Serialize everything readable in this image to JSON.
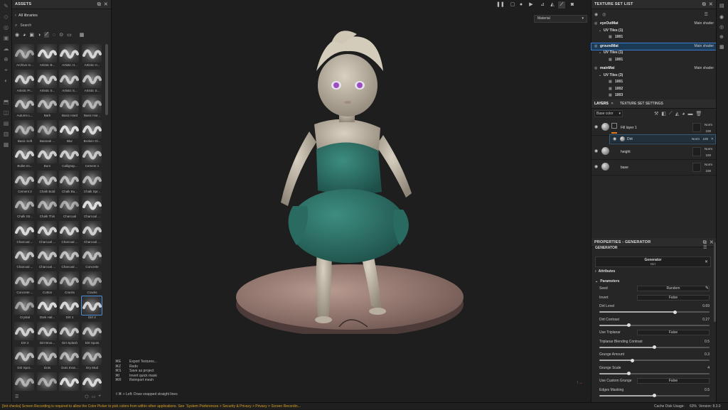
{
  "assets_panel": {
    "title": "ASSETS",
    "library": "All libraries",
    "search_placeholder": "Search",
    "brushes": [
      "Archive In...",
      "Artistic B...",
      "Artistic H...",
      "Artistic H...",
      "Artistic Pr...",
      "Artistic S...",
      "Artistic S...",
      "Artistic S...",
      "Autumn L...",
      "Bark",
      "Basic Hard",
      "Basic Har...",
      "Basic Soft",
      "Basmati ...",
      "Blur",
      "Broken Gl...",
      "Bullet Im...",
      "Burn",
      "Calligrap...",
      "Cement 1",
      "Cement 2",
      "Chalk Bold",
      "Chalk Bu...",
      "Chalk Spr...",
      "Chalk Str...",
      "Chalk Thin",
      "Charcoal",
      "Charcoal ...",
      "Charcoal ...",
      "Charcoal ...",
      "Charcoal ...",
      "Charcoal ...",
      "Charcoal ...",
      "Charcoal ...",
      "Charcoal ...",
      "Concrete",
      "Concrete ...",
      "Cotton",
      "Cracks",
      "Cracks",
      "Crystal",
      "Dark Hal...",
      "Dirt 1",
      "Dirt 2",
      "Dirt 3",
      "Dirt Brus...",
      "Dirt Splash",
      "Dirt Spots",
      "Dirt Spot...",
      "Dots",
      "Dots Eras...",
      "Dry Mud",
      "",
      "",
      "",
      ""
    ],
    "selected_brush": "Dirt 2"
  },
  "viewport": {
    "material_dropdown": "Material",
    "shortcuts": [
      {
        "key": "⌘E",
        "action": "Export Textures..."
      },
      {
        "key": "⌘Z",
        "action": "Redo"
      },
      {
        "key": "⌘S",
        "action": "Save as project"
      },
      {
        "key": "⌘I",
        "action": "Invert quick mask"
      },
      {
        "key": "⌘R",
        "action": "Reimport mesh"
      }
    ],
    "hint": "⇧⌘ + Left: Draw snapped straight lines"
  },
  "texture_set_list": {
    "title": "TEXTURE SET LIST",
    "sets": [
      {
        "name": "eyeOutMat",
        "shader": "Main shader",
        "uv_label": "UV Tiles (1)",
        "tiles": [
          "1001"
        ]
      },
      {
        "name": "groundMat",
        "shader": "Main shader",
        "uv_label": "UV Tiles (1)",
        "tiles": [
          "1001"
        ]
      },
      {
        "name": "mainMat",
        "shader": "Main shader",
        "uv_label": "UV Tiles (3)",
        "tiles": [
          "1001",
          "1002",
          "1003"
        ]
      }
    ],
    "selected": "groundMat"
  },
  "layers_panel": {
    "tab_layers": "LAYERS",
    "tab_settings": "TEXTURE SET SETTINGS",
    "channel": "Base color",
    "layers": [
      {
        "name": "Fill layer 1",
        "blend": "Norm",
        "opacity": "100"
      },
      {
        "name": "Dirt",
        "blend": "Norm",
        "opacity": "100"
      },
      {
        "name": "height",
        "blend": "Norm",
        "opacity": "100"
      },
      {
        "name": "base",
        "blend": "Norm",
        "opacity": "100"
      }
    ]
  },
  "properties": {
    "title": "PROPERTIES - GENERATOR",
    "section": "GENERATOR",
    "generator_name": "Generator",
    "generator_sub": "Dirt",
    "attributes": "Attributes",
    "parameters": "Parameters",
    "params": [
      {
        "label": "Seed",
        "type": "field",
        "value": "Random"
      },
      {
        "label": "Invert",
        "type": "field",
        "value": "False"
      },
      {
        "label": "Dirt Level",
        "type": "slider",
        "value": "0.69",
        "fraction": 0.69
      },
      {
        "label": "Dirt Contrast",
        "type": "slider",
        "value": "0.27",
        "fraction": 0.27
      },
      {
        "label": "Use Triplanar",
        "type": "field",
        "value": "False"
      },
      {
        "label": "Triplanar Blending Contrast",
        "type": "slider",
        "value": "0.5",
        "fraction": 0.5
      },
      {
        "label": "Grunge Amount",
        "type": "slider",
        "value": "0.3",
        "fraction": 0.3
      },
      {
        "label": "Grunge Scale",
        "type": "slider",
        "value": "4",
        "fraction": 0.27
      },
      {
        "label": "Use Custom Grunge",
        "type": "field",
        "value": "False"
      },
      {
        "label": "Edges Masking",
        "type": "slider",
        "value": "0.5",
        "fraction": 0.5
      }
    ]
  },
  "status_bar": {
    "message": "[Init checks] Screen Recording is required to allow the Color Picker to pick colors from within other applications. See `System Preferences > Security & Privacy > Privacy > Screen Recordin...",
    "cache": "Cache Disk Usage:",
    "cache_value": "63%",
    "version": "Version: 8.3.0"
  },
  "colors": {
    "accent": "#3a7bd5",
    "orange": "#e07a1f",
    "skirt": "#2f7a6e"
  }
}
